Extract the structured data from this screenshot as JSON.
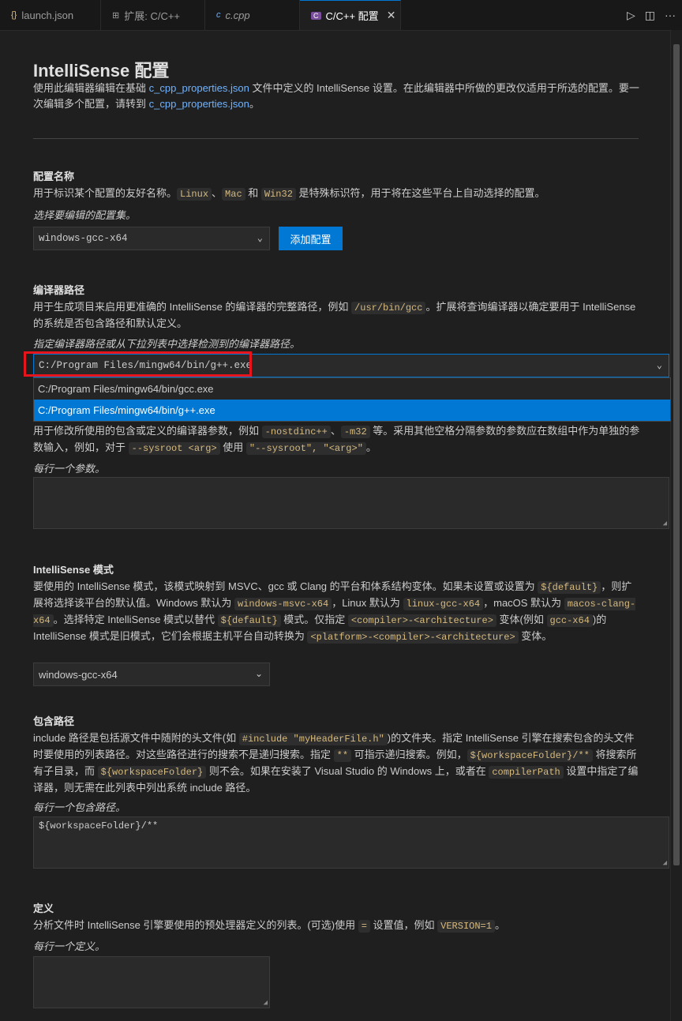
{
  "tabs": [
    {
      "icon": "{}",
      "label": "launch.json"
    },
    {
      "icon": "⊞",
      "label": "扩展: C/C++"
    },
    {
      "icon": "c",
      "label": "c.cpp"
    },
    {
      "icon": "C",
      "label": "C/C++ 配置"
    }
  ],
  "header": {
    "title": "IntelliSense 配置",
    "desc_a": "使用此编辑器编辑在基础 ",
    "desc_link1": "c_cpp_properties.json",
    "desc_b": " 文件中定义的 IntelliSense 设置。在此编辑器中所做的更改仅适用于所选的配置。要一次编辑多个配置，请转到 ",
    "desc_link2": "c_cpp_properties.json",
    "desc_c": "。"
  },
  "config_name": {
    "title": "配置名称",
    "desc_a": "用于标识某个配置的友好名称。",
    "code1": "Linux",
    "sep1": "、",
    "code2": "Mac",
    "and": " 和 ",
    "code3": "Win32",
    "desc_b": " 是特殊标识符，用于将在这些平台上自动选择的配置。",
    "hint": "选择要编辑的配置集。",
    "selected": "windows-gcc-x64",
    "add_button": "添加配置"
  },
  "compiler_path": {
    "title": "编译器路径",
    "desc_a": "用于生成项目来启用更准确的 IntelliSense 的编译器的完整路径，例如 ",
    "code1": "/usr/bin/gcc",
    "desc_b": "。扩展将查询编译器以确定要用于 IntelliSense 的系统是否包含路径和默认定义。",
    "hint": "指定编译器路径或从下拉列表中选择检测到的编译器路径。",
    "value": "C:/Program Files/mingw64/bin/g++.exe",
    "options": [
      "C:/Program Files/mingw64/bin/gcc.exe",
      "C:/Program Files/mingw64/bin/g++.exe"
    ]
  },
  "compiler_args": {
    "desc_a": "用于修改所使用的包含或定义的编译器参数，例如 ",
    "code1": "-nostdinc++",
    "sep1": "、",
    "code2": "-m32",
    "desc_b": " 等。采用其他空格分隔参数的参数应在数组中作为单独的参数输入，例如，对于 ",
    "code3": "--sysroot <arg>",
    "desc_c": " 使用 ",
    "code4": "\"--sysroot\", \"<arg>\"",
    "desc_d": "。",
    "hint": "每行一个参数。"
  },
  "intellisense_mode": {
    "title": "IntelliSense 模式",
    "t1": "要使用的 IntelliSense 模式，该模式映射到 MSVC、gcc 或 Clang 的平台和体系结构变体。如果未设置或设置为 ",
    "c1": "${default}",
    "t2": "，则扩展将选择该平台的默认值。Windows 默认为 ",
    "c2": "windows-msvc-x64",
    "t3": "，Linux 默认为 ",
    "c3": "linux-gcc-x64",
    "t4": "，macOS 默认为 ",
    "c4": "macos-clang-x64",
    "t5": "。选择特定 IntelliSense 模式以替代 ",
    "c5": "${default}",
    "t6": " 模式。仅指定 ",
    "c6": "<compiler>-<architecture>",
    "t7": " 变体(例如 ",
    "c7": "gcc-x64",
    "t8": ")的 IntelliSense 模式是旧模式，它们会根据主机平台自动转换为 ",
    "c8": "<platform>-<compiler>-<architecture>",
    "t9": " 变体。",
    "selected": "windows-gcc-x64"
  },
  "include_path": {
    "title": "包含路径",
    "t1": "include 路径是包括源文件中随附的头文件(如 ",
    "c1": "#include \"myHeaderFile.h\"",
    "t2": ")的文件夹。指定 IntelliSense 引擎在搜索包含的头文件时要使用的列表路径。对这些路径进行的搜索不是递归搜索。指定 ",
    "c2": "**",
    "t3": " 可指示递归搜索。例如，",
    "c3": "${workspaceFolder}/**",
    "t4": " 将搜索所有子目录，而 ",
    "c4": "${workspaceFolder}",
    "t5": " 则不会。如果在安装了 Visual Studio 的 Windows 上，或者在 ",
    "c5": "compilerPath",
    "t6": " 设置中指定了编译器，则无需在此列表中列出系统 include 路径。",
    "hint": "每行一个包含路径。",
    "value": "${workspaceFolder}/**"
  },
  "defines": {
    "title": "定义",
    "t1": "分析文件时 IntelliSense 引擎要使用的预处理器定义的列表。(可选)使用 ",
    "c1": "=",
    "t2": " 设置值，例如 ",
    "c2": "VERSION=1",
    "t3": "。",
    "hint": "每行一个定义。"
  },
  "colors": {
    "accent": "#0078d4",
    "highlight_box": "#e8141b",
    "code_text": "#d7ba7d",
    "link": "#6fb3ff"
  }
}
